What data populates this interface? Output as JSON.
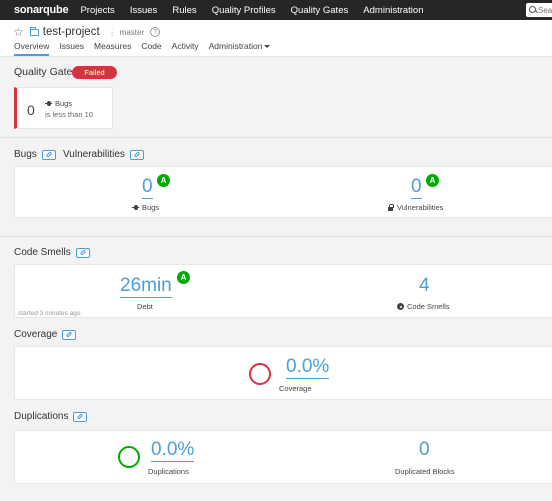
{
  "topbar": {
    "logo": "sonarqube",
    "nav": [
      "Projects",
      "Issues",
      "Rules",
      "Quality Profiles",
      "Quality Gates",
      "Administration"
    ],
    "search_placeholder": "Sea"
  },
  "project": {
    "name": "test-project",
    "branch": "master",
    "help_glyph": "?",
    "tabs": [
      "Overview",
      "Issues",
      "Measures",
      "Code",
      "Activity",
      "Administration"
    ]
  },
  "quality_gate": {
    "title": "Quality Gate",
    "status": "Failed",
    "condition": {
      "value": "0",
      "metric": "Bugs",
      "text": "is less than 10"
    }
  },
  "bugs_vulns": {
    "title_bugs": "Bugs",
    "title_vulns": "Vulnerabilities",
    "bugs": {
      "value": "0",
      "grade": "A",
      "label": "Bugs"
    },
    "vulnerabilities": {
      "value": "0",
      "grade": "A",
      "label": "Vulnerabilities"
    }
  },
  "code_smells": {
    "title": "Code Smells",
    "debt": {
      "value": "26min",
      "grade": "A",
      "label": "Debt"
    },
    "smells": {
      "value": "4",
      "label": "Code Smells"
    },
    "started": "started 3 minutes ago"
  },
  "coverage": {
    "title": "Coverage",
    "value": "0.0%",
    "label": "Coverage",
    "ring_color": "#d4333f"
  },
  "duplications": {
    "title": "Duplications",
    "value": "0.0%",
    "label": "Duplications",
    "blocks_value": "0",
    "blocks_label": "Duplicated Blocks",
    "ring_color": "#00aa00"
  },
  "colors": {
    "accent": "#4b9fd5",
    "failed": "#d4333f",
    "grade_a": "#00aa00",
    "topbar": "#262626"
  }
}
